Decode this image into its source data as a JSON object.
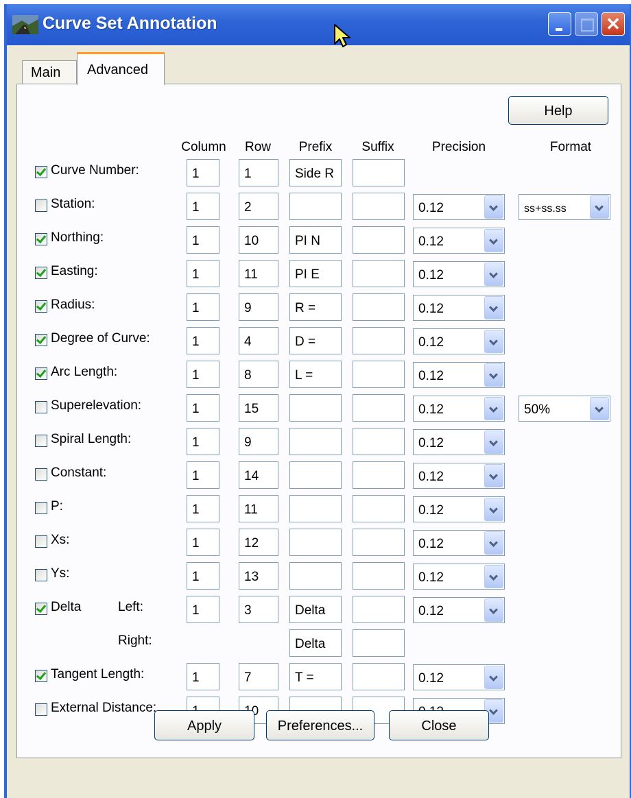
{
  "window": {
    "title": "Curve Set Annotation"
  },
  "tabs": [
    "Main",
    "Advanced"
  ],
  "help_label": "Help",
  "headers": {
    "column": "Column",
    "row": "Row",
    "prefix": "Prefix",
    "suffix": "Suffix",
    "precision": "Precision",
    "format": "Format"
  },
  "rows": [
    {
      "label": "Curve Number:",
      "checked": true,
      "column": "1",
      "row": "1",
      "prefix": "Side R",
      "suffix": ""
    },
    {
      "label": "Station:",
      "checked": false,
      "column": "1",
      "row": "2",
      "prefix": "",
      "suffix": "",
      "precision": "0.12",
      "format": "ss+ss.ss"
    },
    {
      "label": "Northing:",
      "checked": true,
      "column": "1",
      "row": "10",
      "prefix": "PI N",
      "suffix": "",
      "precision": "0.12"
    },
    {
      "label": "Easting:",
      "checked": true,
      "column": "1",
      "row": "11",
      "prefix": "PI E",
      "suffix": "",
      "precision": "0.12"
    },
    {
      "label": "Radius:",
      "checked": true,
      "column": "1",
      "row": "9",
      "prefix": "R =",
      "suffix": "",
      "precision": "0.12"
    },
    {
      "label": "Degree of Curve:",
      "checked": true,
      "column": "1",
      "row": "4",
      "prefix": "D =",
      "suffix": "",
      "precision": "0.12"
    },
    {
      "label": "Arc Length:",
      "checked": true,
      "column": "1",
      "row": "8",
      "prefix": "L =",
      "suffix": "",
      "precision": "0.12"
    },
    {
      "label": "Superelevation:",
      "checked": false,
      "column": "1",
      "row": "15",
      "prefix": "",
      "suffix": "",
      "precision": "0.12",
      "format": "50%"
    },
    {
      "label": "Spiral Length:",
      "checked": false,
      "column": "1",
      "row": "9",
      "prefix": "",
      "suffix": "",
      "precision": "0.12"
    },
    {
      "label": "Constant:",
      "checked": false,
      "column": "1",
      "row": "14",
      "prefix": "",
      "suffix": "",
      "precision": "0.12"
    },
    {
      "label": "P:",
      "checked": false,
      "column": "1",
      "row": "11",
      "prefix": "",
      "suffix": "",
      "precision": "0.12"
    },
    {
      "label": "Xs:",
      "checked": false,
      "column": "1",
      "row": "12",
      "prefix": "",
      "suffix": "",
      "precision": "0.12"
    },
    {
      "label": "Ys:",
      "checked": false,
      "column": "1",
      "row": "13",
      "prefix": "",
      "suffix": "",
      "precision": "0.12"
    },
    {
      "label": "Delta",
      "sublabel": "Left:",
      "checked": true,
      "column": "1",
      "row": "3",
      "prefix": "Delta",
      "suffix": "",
      "precision": "0.12"
    },
    {
      "sublabel": "Right:",
      "prefix": "Delta",
      "suffix": ""
    },
    {
      "label": "Tangent Length:",
      "checked": true,
      "column": "1",
      "row": "7",
      "prefix": "T =",
      "suffix": "",
      "precision": "0.12"
    },
    {
      "label": "External Distance:",
      "checked": false,
      "column": "1",
      "row": "10",
      "prefix": "",
      "suffix": "",
      "precision": "0.12"
    }
  ],
  "buttons": {
    "apply": "Apply",
    "preferences": "Preferences...",
    "close": "Close"
  },
  "colors": {
    "titlebar": "#2f65d6",
    "check": "#21a121",
    "tab_highlight": "#ff9c28",
    "close_button": "#c6361a"
  }
}
